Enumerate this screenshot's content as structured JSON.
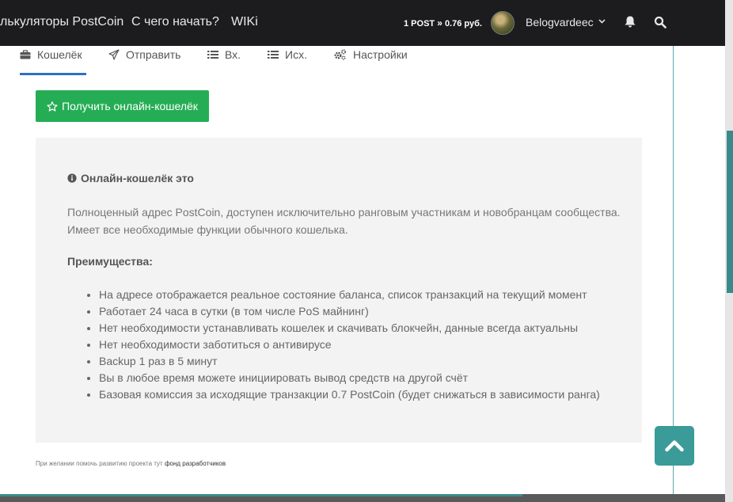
{
  "navbar": {
    "links": [
      "лькуляторы PostCoin",
      "С чего начать?",
      "WIKi"
    ],
    "price": {
      "coin": "1 POST",
      "separator": "»",
      "value": "0.76 руб."
    },
    "user": {
      "name": "Belogvardeec"
    }
  },
  "tabs": [
    {
      "label": "Кошелёк",
      "icon": "briefcase-icon",
      "active": true
    },
    {
      "label": "Отправить",
      "icon": "paper-plane-icon"
    },
    {
      "label": "Вх.",
      "icon": "list-icon"
    },
    {
      "label": "Исх.",
      "icon": "list-icon"
    },
    {
      "label": "Настройки",
      "icon": "cogs-icon"
    }
  ],
  "get_wallet_button": "Получить онлайн-кошелёк",
  "info": {
    "title": "Онлайн-кошелёк это",
    "description": "Полноценный адрес PostCoin, доступен исключительно ранговым участникам и новобранцам сообщества. Имеет все необходимые функции обычного кошелька.",
    "advantages_title": "Преимущества:",
    "advantages": [
      "На адресе отображается реальное состояние баланса, список транзакций на текущий момент",
      "Работает 24 часа в сутки (в том числе PoS майнинг)",
      "Нет необходимости устанавливать кошелек и скачивать блокчейн, данные всегда актуальны",
      "Нет необходимости заботиться о антивирусе",
      "Backup 1 раз в 5 минут",
      "Вы в любое время можете инициировать вывод средств на другой счёт",
      "Базовая комиссия за исходящие транзакции 0.7 PostCoin (будет снижаться в зависимости ранга)"
    ]
  },
  "footer": {
    "text": "При желании помочь развитию проекта тут",
    "link": "фонд разработчиков"
  },
  "colors": {
    "accent": "#2d71c3",
    "button_green": "#25ad55",
    "scroll_top": "#3a9b99"
  }
}
